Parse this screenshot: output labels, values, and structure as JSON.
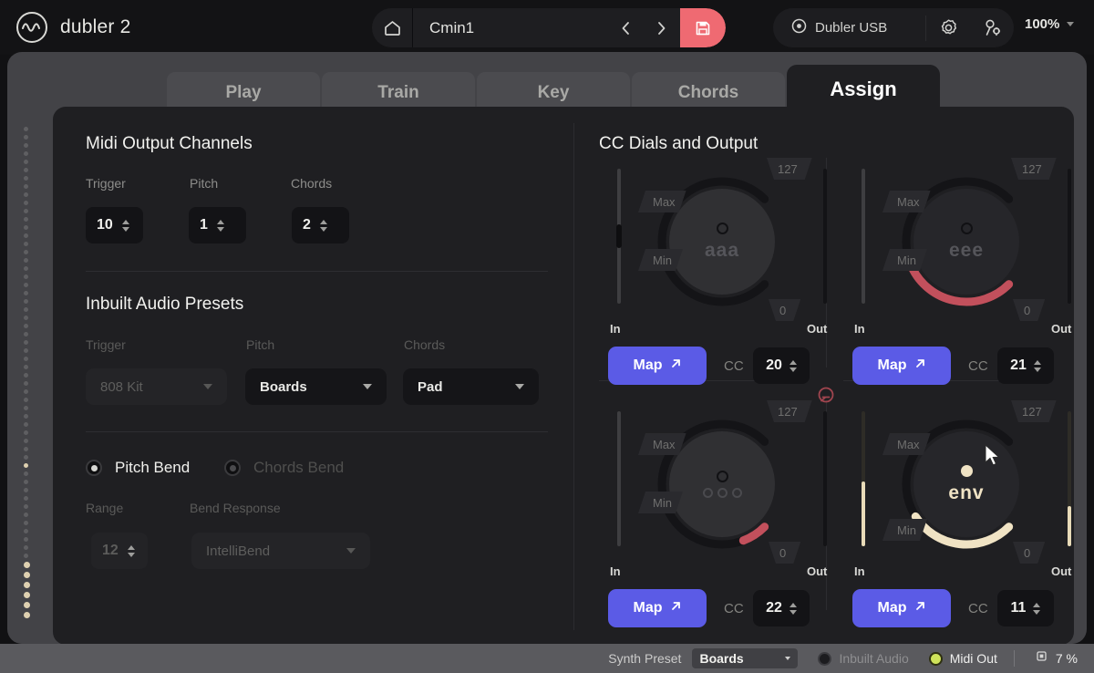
{
  "header": {
    "brand": "dubler 2",
    "brand_icon": "dubler-wave-logo-icon",
    "home_icon": "home-icon",
    "preset_name": "Cmin1",
    "prev_icon": "chevron-left-icon",
    "next_icon": "chevron-right-icon",
    "save_icon": "save-disk-icon",
    "save_color": "#ef6a72",
    "device_icon": "target-dot-icon",
    "device_name": "Dubler USB",
    "settings_icon": "gear-icon",
    "account_icon": "user-settings-icon",
    "zoom_level": "100%",
    "zoom_caret_icon": "chevron-down-icon"
  },
  "tabs": [
    {
      "label": "Play",
      "active": false
    },
    {
      "label": "Train",
      "active": false
    },
    {
      "label": "Key",
      "active": false
    },
    {
      "label": "Chords",
      "active": false
    },
    {
      "label": "Assign",
      "active": true
    }
  ],
  "sidebar": {
    "meter_icon": "vertical-level-meter",
    "logo_icon": "dubler-knot-logo-icon"
  },
  "left_panel": {
    "midi_output": {
      "title": "Midi Output Channels",
      "fields": [
        {
          "label": "Trigger",
          "value": "10",
          "disabled": false
        },
        {
          "label": "Pitch",
          "value": "1",
          "disabled": false
        },
        {
          "label": "Chords",
          "value": "2",
          "disabled": false
        }
      ]
    },
    "inbuilt_presets": {
      "title": "Inbuilt Audio Presets",
      "fields": [
        {
          "label": "Trigger",
          "value": "808 Kit",
          "disabled": true
        },
        {
          "label": "Pitch",
          "value": "Boards",
          "disabled": false
        },
        {
          "label": "Chords",
          "value": "Pad",
          "disabled": false
        }
      ]
    },
    "bend": {
      "options": [
        {
          "label": "Pitch Bend",
          "selected": true
        },
        {
          "label": "Chords Bend",
          "selected": false
        }
      ],
      "range_label": "Range",
      "range_value": "12",
      "response_label": "Bend Response",
      "response_value": "IntelliBend"
    }
  },
  "cc_section": {
    "title": "CC Dials and Output",
    "in_label": "In",
    "out_label": "Out",
    "max_label": "Max",
    "min_label": "Min",
    "cc_label": "CC",
    "map_label": "Map",
    "map_icon": "arrow-up-right-icon",
    "map_color": "#5b5be6",
    "center_icon": "link-node-icon",
    "dials": [
      {
        "name": "aaa",
        "knob_label": "aaa",
        "arc_value": 0,
        "arc_color": "#1b1b1e",
        "out_max": "127",
        "out_min": "0",
        "cc": "20",
        "in_value": 50,
        "out_value": 100,
        "style": "ring-light"
      },
      {
        "name": "eee",
        "knob_label": "eee",
        "arc_value": 42,
        "arc_color": "#c2505c",
        "out_max": "127",
        "out_min": "0",
        "cc": "21",
        "in_value": 100,
        "out_value": 100,
        "style": "ring-dark"
      },
      {
        "name": "ooo",
        "knob_label": "ooo",
        "arc_value": 9,
        "arc_color": "#c2505c",
        "out_max": "127",
        "out_min": "0",
        "cc": "22",
        "in_value": 100,
        "out_value": 100,
        "style": "ring-light"
      },
      {
        "name": "env",
        "knob_label": "env",
        "arc_value": 38,
        "arc_color": "#f0e3c4",
        "out_max": "127",
        "out_min": "0",
        "cc": "11",
        "in_value": 48,
        "out_value": 30,
        "style": "ring-accent"
      }
    ]
  },
  "status_bar": {
    "synth_preset_label": "Synth Preset",
    "synth_preset_value": "Boards",
    "synth_preset_caret_icon": "caret-down-icon",
    "inbuilt_audio_label": "Inbuilt Audio",
    "inbuilt_audio_on": false,
    "inbuilt_audio_color": "#1c1c1f",
    "midi_out_label": "Midi Out",
    "midi_out_on": true,
    "midi_out_color": "#cfe35a",
    "cpu_icon": "cpu-chip-icon",
    "cpu_value": "7 %"
  }
}
